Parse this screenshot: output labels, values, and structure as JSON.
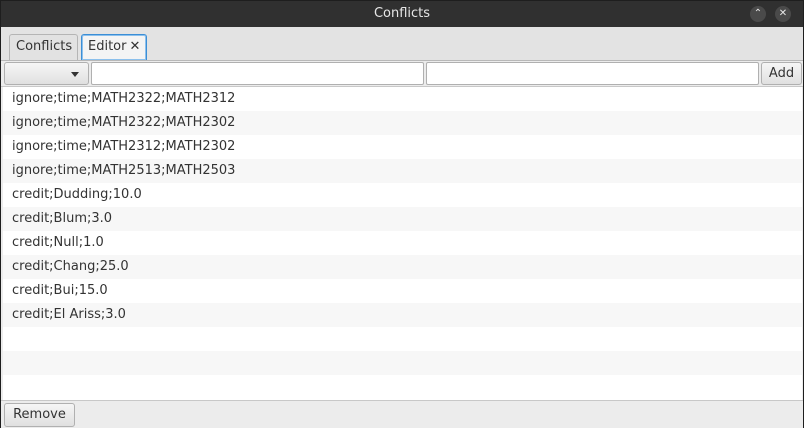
{
  "window": {
    "title": "Conflicts",
    "minimize_glyph": "⌃",
    "close_glyph": "✕"
  },
  "tabs": [
    {
      "label": "Conflicts",
      "active": false
    },
    {
      "label": "Editor",
      "active": true,
      "close_glyph": "✕"
    }
  ],
  "toolbar": {
    "combo_value": "",
    "field1_value": "",
    "field2_value": "",
    "add_label": "Add"
  },
  "list": {
    "items": [
      "ignore;time;MATH2322;MATH2312",
      "ignore;time;MATH2322;MATH2302",
      "ignore;time;MATH2312;MATH2302",
      "ignore;time;MATH2513;MATH2503",
      "credit;Dudding;10.0",
      "credit;Blum;3.0",
      "credit;Null;1.0",
      "credit;Chang;25.0",
      "credit;Bui;15.0",
      "credit;El Ariss;3.0"
    ]
  },
  "footer": {
    "remove_label": "Remove"
  }
}
